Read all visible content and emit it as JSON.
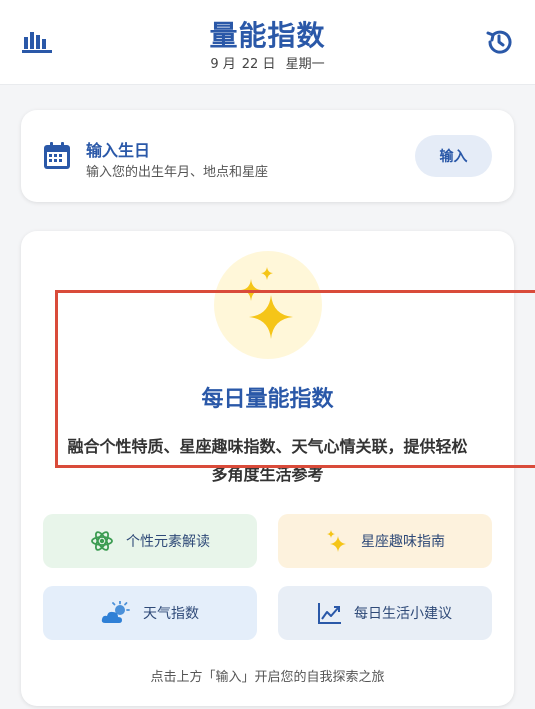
{
  "header": {
    "title": "量能指数",
    "date": {
      "month": "9 月",
      "day": "22 日",
      "weekday": "星期一"
    },
    "icons": {
      "left": "bar-chart-icon",
      "right": "history-icon"
    }
  },
  "birthday": {
    "title": "输入生日",
    "subtitle": "输入您的出生年月、地点和星座",
    "button_label": "输入",
    "icon": "calendar-icon"
  },
  "main": {
    "title": "每日量能指数",
    "description": "融合个性特质、星座趣味指数、天气心情关联，提供轻松多角度生活参考",
    "icon": "sparkles-icon",
    "features": [
      {
        "label": "个性元素解读",
        "icon": "atom-icon"
      },
      {
        "label": "星座趣味指南",
        "icon": "sparkle-icon"
      },
      {
        "label": "天气指数",
        "icon": "sun-cloud-icon"
      },
      {
        "label": "每日生活小建议",
        "icon": "trend-chart-icon"
      }
    ],
    "hint": "点击上方「输入」开启您的自我探索之旅"
  },
  "colors": {
    "accent": "#2a58a8",
    "highlight": "#d94b3a",
    "sparkle": "#f5c518"
  }
}
